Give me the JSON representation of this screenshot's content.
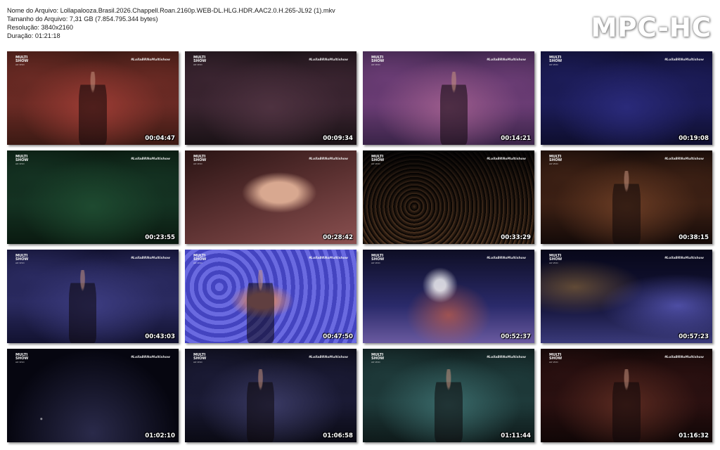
{
  "file_info": {
    "name_line": "Nome do Arquivo: Lollapalooza.Brasil.2026.Chappell.Roan.2160p.WEB-DL.HLG.HDR.AAC2.0.H.265-JL92 (1).mkv",
    "size_line": "Tamanho do Arquivo: 7,31 GB (7.854.795.344 bytes)",
    "resolution_line": "Resolução: 3840x2160",
    "duration_line": "Duração: 01:21:18"
  },
  "logo": "MPC-HC",
  "channel_watermark": {
    "line1": "MULTI",
    "line2": "SHOW",
    "line3": "AO VIVO",
    "hashtag": "#LollaBRNoMultishow"
  },
  "thumbnails": [
    {
      "time": "00:04:47",
      "palette": [
        "#3c1a14",
        "#6a2a24",
        "#9c3c34"
      ],
      "scene": "stage-red"
    },
    {
      "time": "00:09:34",
      "palette": [
        "#1a1216",
        "#3a2430",
        "#4e3240"
      ],
      "scene": "stage-dark"
    },
    {
      "time": "00:14:21",
      "palette": [
        "#3a2448",
        "#6a3c74",
        "#9c5c8c"
      ],
      "scene": "stage-purple"
    },
    {
      "time": "00:19:08",
      "palette": [
        "#0e0e2e",
        "#1c1c58",
        "#2a2a7a"
      ],
      "scene": "stage-blue"
    },
    {
      "time": "00:23:55",
      "palette": [
        "#0a1a10",
        "#143222",
        "#1e4a30"
      ],
      "scene": "stage-green"
    },
    {
      "time": "00:28:42",
      "palette": [
        "#2a1414",
        "#5a3030",
        "#8a5050"
      ],
      "scene": "crowd-close"
    },
    {
      "time": "00:33:29",
      "palette": [
        "#1a1410",
        "#4a3c30",
        "#8a7058"
      ],
      "scene": "crowd-wide"
    },
    {
      "time": "00:38:15",
      "palette": [
        "#140a08",
        "#3c2014",
        "#6a3c24"
      ],
      "scene": "stage-orange"
    },
    {
      "time": "00:43:03",
      "palette": [
        "#121230",
        "#2a2a60",
        "#3c3c80"
      ],
      "scene": "singer-blue"
    },
    {
      "time": "00:47:50",
      "palette": [
        "#2a2a90",
        "#4444c0",
        "#6a6ae0"
      ],
      "scene": "singer-violet"
    },
    {
      "time": "00:52:37",
      "palette": [
        "#0e0e24",
        "#2a2a6a",
        "#6a5aa0"
      ],
      "scene": "stage-lights"
    },
    {
      "time": "00:57:23",
      "palette": [
        "#08081a",
        "#14143a",
        "#3a3a7a"
      ],
      "scene": "aerial-night"
    },
    {
      "time": "01:02:10",
      "palette": [
        "#060610",
        "#14142a",
        "#2a2a4a"
      ],
      "scene": "crowd-night"
    },
    {
      "time": "01:06:58",
      "palette": [
        "#0a0a14",
        "#1a1a34",
        "#3a3a64"
      ],
      "scene": "singer-dark"
    },
    {
      "time": "01:11:44",
      "palette": [
        "#0e1a1a",
        "#1e3a3a",
        "#3a6a6a"
      ],
      "scene": "stage-teal"
    },
    {
      "time": "01:16:32",
      "palette": [
        "#100606",
        "#2a1010",
        "#5a2a20"
      ],
      "scene": "stage-red-dark"
    }
  ]
}
